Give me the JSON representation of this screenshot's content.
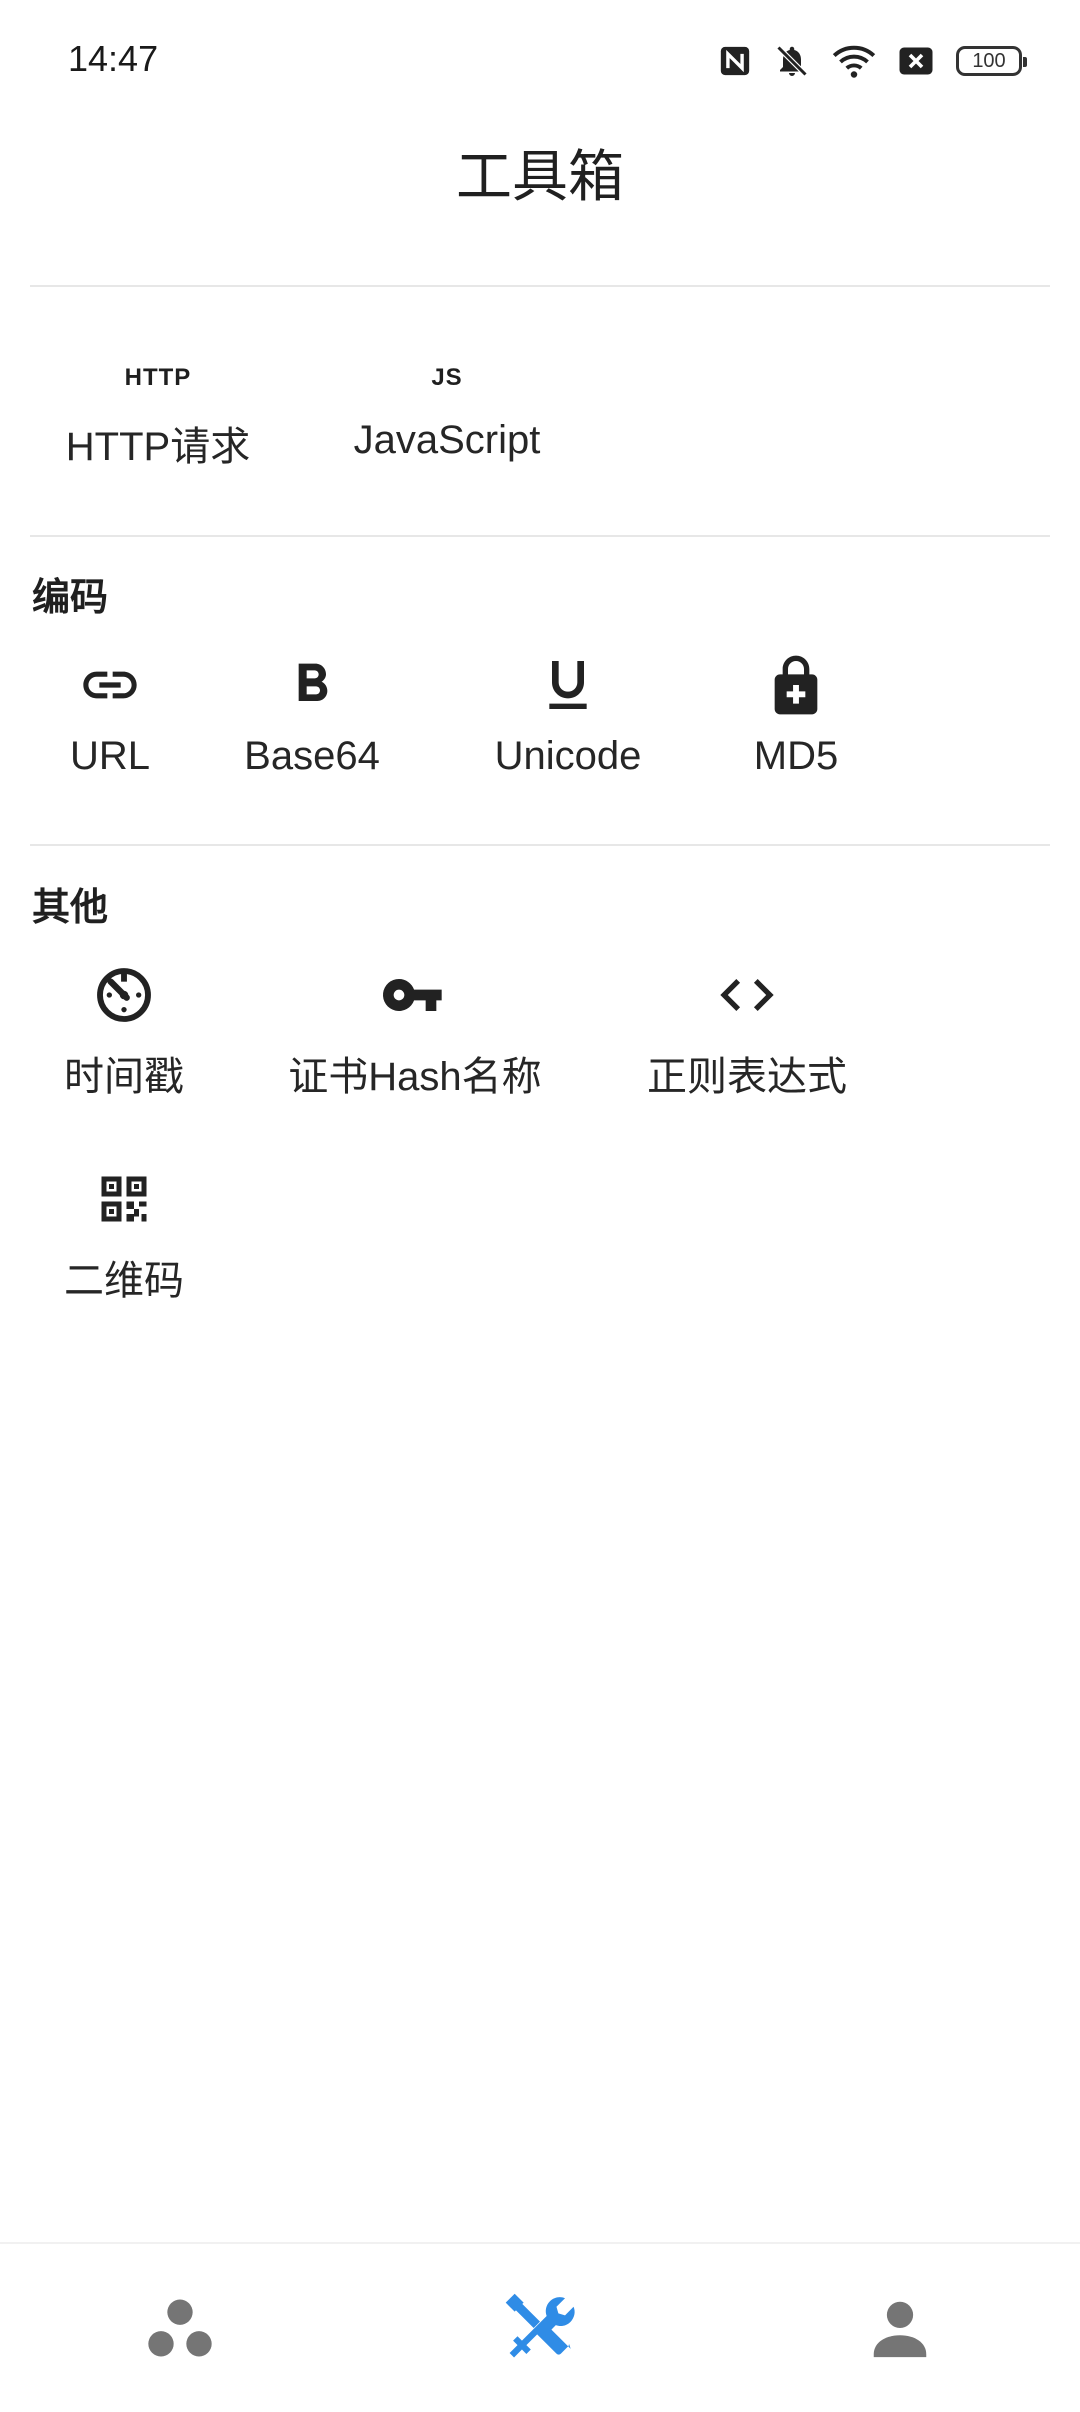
{
  "status_bar": {
    "time": "14:47",
    "icons": [
      "nfc-icon",
      "bell-off-icon",
      "wifi-icon",
      "sim-error-icon",
      "battery-icon"
    ],
    "battery_level": "100"
  },
  "header": {
    "title": "工具箱"
  },
  "sections": {
    "top": {
      "tools": [
        {
          "icon_text": "HTTP",
          "label": "HTTP请求"
        },
        {
          "icon_text": "JS",
          "label": "JavaScript"
        }
      ]
    },
    "encoding": {
      "title": "编码",
      "tools": [
        {
          "icon": "link-icon",
          "label": "URL"
        },
        {
          "icon": "bold-icon",
          "label": "Base64"
        },
        {
          "icon": "underline-icon",
          "label": "Unicode"
        },
        {
          "icon": "lock-icon",
          "label": "MD5"
        }
      ]
    },
    "other": {
      "title": "其他",
      "tools": [
        {
          "icon": "timer-icon",
          "label": "时间戳"
        },
        {
          "icon": "key-icon",
          "label": "证书Hash名称"
        },
        {
          "icon": "code-icon",
          "label": "正则表达式"
        },
        {
          "icon": "qrcode-icon",
          "label": "二维码"
        }
      ]
    }
  },
  "bottom_nav": {
    "items": [
      {
        "icon": "bubbles-icon",
        "active": false
      },
      {
        "icon": "tools-icon",
        "active": true
      },
      {
        "icon": "person-icon",
        "active": false
      }
    ],
    "active_color": "#2F8CE6",
    "inactive_color": "#757575"
  }
}
